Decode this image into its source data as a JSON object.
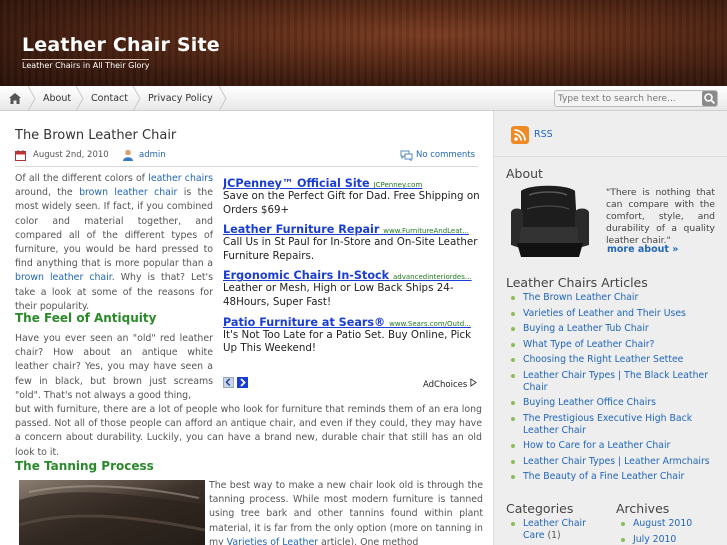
{
  "header": {
    "site_title": "Leather Chair Site",
    "site_description": "Leather Chairs in All Their Glory"
  },
  "nav": {
    "home_icon": "home-icon",
    "items": [
      {
        "label": "About"
      },
      {
        "label": "Contact"
      },
      {
        "label": "Privacy Policy"
      }
    ],
    "search_placeholder": "Type text to search here...",
    "search_icon": "search-icon"
  },
  "post": {
    "title": "The Brown Leather Chair",
    "date": "August 2nd, 2010",
    "author": "admin",
    "comments": "No comments",
    "intro": {
      "p1": "Of all the different colors of ",
      "link1": "leather chairs",
      "p2": " around, the ",
      "link2": "brown leather chair",
      "p3": " is the most widely seen. If fact, if you combined color and material together, and compared all of the different types of furniture, you would be hard pressed to find anything that is more popular than a ",
      "link3": "brown leather chair",
      "p4": ". Why is that? Let's take a look at some of the reasons for their popularity."
    },
    "section1_heading": "The Feel of Antiquity",
    "section1_text_a": "Have you ever seen an \"old\" red leather chair? How about an antique white leather chair? Yes, you may have seen a few in black, but brown just screams \"old\". That's not always a good thing,",
    "section1_text_b": "but with furniture, there are a lot of people who look for furniture that reminds them of an era long passed. Not all of those people can afford an antique chair, and even if they could, they may have a concern about durability. Luckily, you can have a brand new, durable chair that still has an old look to it.",
    "section2_heading": "The Tanning Process",
    "section2_text_a": "The best way to make a new chair look old is through the tanning process. While most modern furniture is tanned using tree bark and other tannins found within plant material, it is far from the only option (more on tanning in my ",
    "section2_link": "Varieties of Leather",
    "section2_text_b": " article). One method"
  },
  "ads": [
    {
      "title": "JCPenney™ Official Site",
      "url": "JCPenney.com",
      "text": "Save on the Perfect Gift for Dad. Free Shipping on Orders $69+"
    },
    {
      "title": "Leather Furniture Repair",
      "url": "www.FurnitureAndLeat...",
      "text": "Call Us in St Paul for In-Store and On-Site Leather Furniture Repairs."
    },
    {
      "title": "Ergonomic Chairs In-Stock",
      "url": "advancedinteriordes...",
      "text": "Leather or Mesh, High or Low Back Ships 24-48Hours, Super Fast!"
    },
    {
      "title": "Patio Furniture at Sears®",
      "url": "www.Sears.com/Outd...",
      "text": "It's Not Too Late for a Patio Set. Buy Online, Pick Up This Weekend!"
    }
  ],
  "adchoices_label": "AdChoices",
  "sidebar": {
    "rss_label": "RSS",
    "about_heading": "About",
    "about_quote": "\"There is nothing that can compare with the comfort, style, and durability of a quality leather chair.\"",
    "about_more": "more about »",
    "articles_heading": "Leather Chairs Articles",
    "articles": [
      "The Brown Leather Chair",
      "Varieties of Leather and Their Uses",
      "Buying a Leather Tub Chair",
      "What Type of Leather Chair?",
      "Choosing the Right Leather Settee",
      "Leather Chair Types | The Black Leather Chair",
      "Buying Leather Office Chairs",
      "The Prestigious Executive High Back Leather Chair",
      "How to Care for a Leather Chair",
      "Leather Chair Types | Leather Armchairs",
      "The Beauty of a Fine Leather Chair"
    ],
    "categories_heading": "Categories",
    "categories": [
      {
        "label": "Leather Chair Care",
        "count": "(1)"
      }
    ],
    "archives_heading": "Archives",
    "archives": [
      "August 2010",
      "July 2010"
    ]
  },
  "colors": {
    "link": "#2266bb",
    "heading_green": "#2a8a2a",
    "ad_title": "#1a3dd6",
    "ad_url": "#1f7a1f",
    "rss_orange": "#f08a24"
  }
}
